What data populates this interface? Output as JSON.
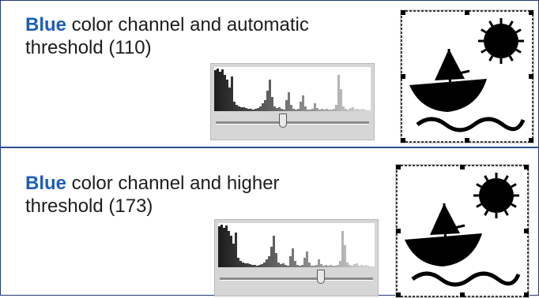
{
  "sections": [
    {
      "channel": "Blue",
      "text_line1": " color channel and automatic",
      "text_line2": "threshold (110)",
      "threshold": 110
    },
    {
      "channel": "Blue",
      "text_line1": " color channel and higher",
      "text_line2": "threshold (173)",
      "threshold": 173
    }
  ],
  "colors": {
    "channel_label": "#1f5fb3",
    "text": "#1d1d1d",
    "border": "#1f3b73"
  }
}
